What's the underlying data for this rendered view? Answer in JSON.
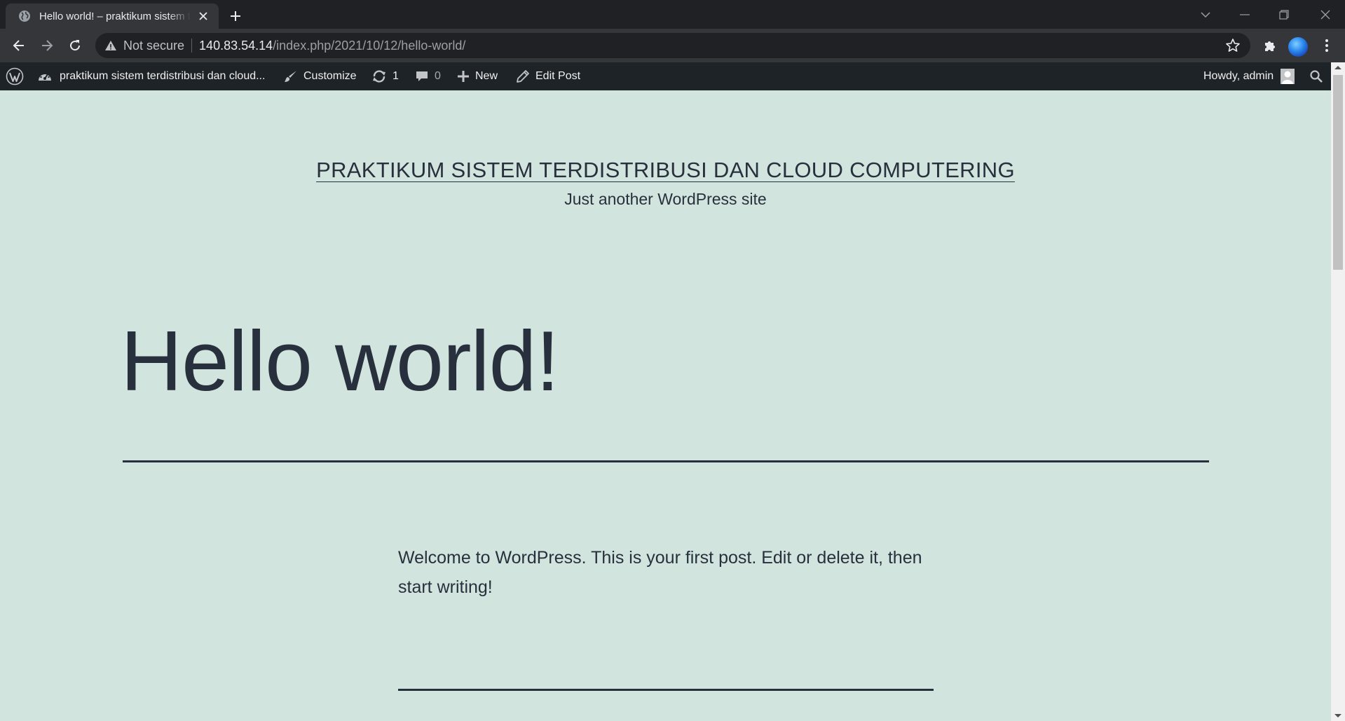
{
  "browser": {
    "tab_title": "Hello world! – praktikum sistem terdistribusi dan cloud computering",
    "security_label": "Not secure",
    "url_host": "140.83.54.14",
    "url_path": "/index.php/2021/10/12/hello-world/"
  },
  "adminbar": {
    "site_name": "praktikum sistem terdistribusi dan cloud...",
    "customize": "Customize",
    "updates_count": "1",
    "comments_count": "0",
    "new": "New",
    "edit_post": "Edit Post",
    "howdy": "Howdy, admin"
  },
  "site": {
    "title": "PRAKTIKUM SISTEM TERDISTRIBUSI DAN CLOUD COMPUTERING",
    "description": "Just another WordPress site"
  },
  "post": {
    "title": "Hello world!",
    "body": "Welcome to WordPress. This is your first post. Edit or delete it, then start writing!"
  },
  "colors": {
    "page_background": "#d1e4dd",
    "text": "#28303d",
    "adminbar": "#1d2327"
  }
}
